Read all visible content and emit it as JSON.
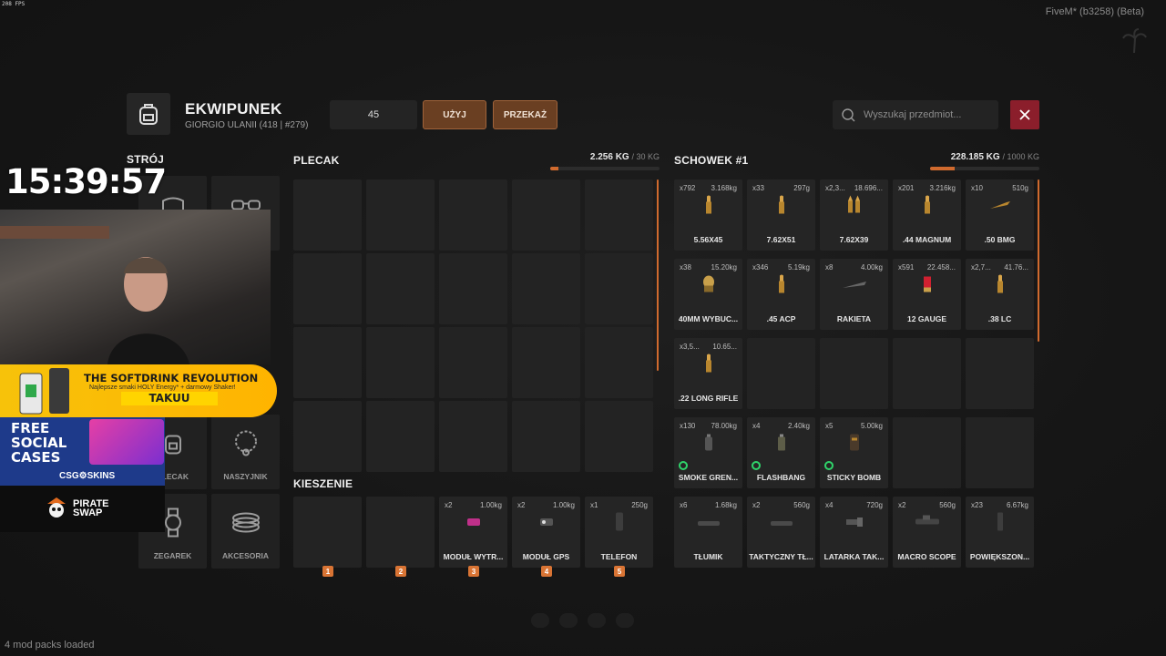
{
  "fps": "208 FPS",
  "client": "FiveM* (b3258) (Beta)",
  "mod_packs": "4 mod packs loaded",
  "header": {
    "title": "EKWIPUNEK",
    "subtitle": "GIORGIO ULANII (418 | #279)",
    "quantity": "45",
    "use_label": "UŻYJ",
    "give_label": "PRZEKAŻ",
    "search_placeholder": "Wyszukaj przedmiot..."
  },
  "outfit": {
    "title": "STRÓJ",
    "slots": [
      {
        "name": "",
        "icon": "hat-icon"
      },
      {
        "name": "",
        "icon": "glasses-icon"
      },
      {
        "name": "PLECAK",
        "icon": "backpack-icon"
      },
      {
        "name": "NASZYJNIK",
        "icon": "necklace-icon"
      },
      {
        "name": "ZEGAREK",
        "icon": "watch-icon"
      },
      {
        "name": "AKCESORIA",
        "icon": "bracelet-icon"
      }
    ]
  },
  "backpack": {
    "title": "PLECAK",
    "weight": "2.256 KG",
    "max": "/ 30 KG",
    "fill": 0.075
  },
  "pockets": {
    "title": "KIESZENIE",
    "slots": [
      {
        "count": "",
        "weight": "",
        "name": "",
        "hotkey": "1",
        "icon": ""
      },
      {
        "count": "",
        "weight": "",
        "name": "",
        "hotkey": "2",
        "icon": ""
      },
      {
        "count": "x2",
        "weight": "1.00kg",
        "name": "MODUŁ WYTR...",
        "hotkey": "3",
        "icon": "module-icon"
      },
      {
        "count": "x2",
        "weight": "1.00kg",
        "name": "MODUŁ GPS",
        "hotkey": "4",
        "icon": "gps-module-icon"
      },
      {
        "count": "x1",
        "weight": "250g",
        "name": "TELEFON",
        "hotkey": "5",
        "icon": "phone-icon"
      }
    ]
  },
  "storage": {
    "title": "SCHOWEK #1",
    "weight": "228.185 KG",
    "max": "/ 1000 KG",
    "fill": 0.228,
    "rows": [
      [
        {
          "count": "x792",
          "weight": "3.168kg",
          "name": "5.56X45",
          "icon": "ammo-icon",
          "ring": false
        },
        {
          "count": "x33",
          "weight": "297g",
          "name": "7.62X51",
          "icon": "ammo-icon",
          "ring": false
        },
        {
          "count": "x2,3...",
          "weight": "18.696...",
          "name": "7.62X39",
          "icon": "ammo-pair-icon",
          "ring": false
        },
        {
          "count": "x201",
          "weight": "3.216kg",
          "name": ".44 MAGNUM",
          "icon": "ammo-icon",
          "ring": false
        },
        {
          "count": "x10",
          "weight": "510g",
          "name": ".50 BMG",
          "icon": "long-round-icon",
          "ring": false
        }
      ],
      [
        {
          "count": "x38",
          "weight": "15.20kg",
          "name": "40MM WYBUC...",
          "icon": "grenade-round-icon",
          "ring": false
        },
        {
          "count": "x346",
          "weight": "5.19kg",
          "name": ".45 ACP",
          "icon": "ammo-icon",
          "ring": false
        },
        {
          "count": "x8",
          "weight": "4.00kg",
          "name": "RAKIETA",
          "icon": "rocket-icon",
          "ring": false
        },
        {
          "count": "x591",
          "weight": "22.458...",
          "name": "12 GAUGE",
          "icon": "shell-icon",
          "ring": false
        },
        {
          "count": "x2,7...",
          "weight": "41.76...",
          "name": ".38 LC",
          "icon": "ammo-icon",
          "ring": false
        }
      ],
      [
        {
          "count": "x3,5...",
          "weight": "10.65...",
          "name": ".22 LONG RIFLE",
          "icon": "ammo-icon",
          "ring": false
        },
        null,
        null,
        null,
        null
      ],
      [
        {
          "count": "x130",
          "weight": "78.00kg",
          "name": "SMOKE GREN...",
          "icon": "smoke-grenade-icon",
          "ring": true
        },
        {
          "count": "x4",
          "weight": "2.40kg",
          "name": "FLASHBANG",
          "icon": "flashbang-icon",
          "ring": true
        },
        {
          "count": "x5",
          "weight": "5.00kg",
          "name": "STICKY BOMB",
          "icon": "sticky-bomb-icon",
          "ring": true
        },
        null,
        null
      ],
      [
        {
          "count": "x6",
          "weight": "1.68kg",
          "name": "TŁUMIK",
          "icon": "suppressor-icon",
          "ring": false
        },
        {
          "count": "x2",
          "weight": "560g",
          "name": "TAKTYCZNY TŁ...",
          "icon": "suppressor-icon",
          "ring": false
        },
        {
          "count": "x4",
          "weight": "720g",
          "name": "LATARKA TAK...",
          "icon": "flashlight-icon",
          "ring": false
        },
        {
          "count": "x2",
          "weight": "560g",
          "name": "MACRO SCOPE",
          "icon": "scope-icon",
          "ring": false
        },
        {
          "count": "x23",
          "weight": "6.67kg",
          "name": "POWIĘKSZON...",
          "icon": "magazine-icon",
          "ring": false
        }
      ]
    ]
  },
  "overlay": {
    "clock": "15:39:57",
    "banner_title": "THE SOFTDRINK REVOLUTION",
    "banner_sub": "Najlepsze smaki HOLY Energy* + darmowy Shaker!",
    "banner_code": "TAKUU",
    "promo_title": "FREE SOCIAL CASES",
    "promo_brand": "CSG⚙SKINS",
    "pirate": "PIRATE SWAP"
  },
  "colors": {
    "accent": "#d06a2e",
    "button": "#6a3f22",
    "close": "#8b1e2b",
    "ring": "#2fd36a"
  }
}
